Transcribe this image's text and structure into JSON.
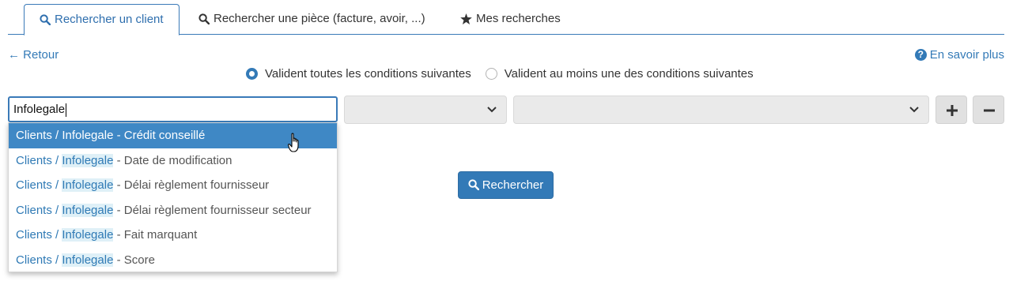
{
  "tabs": [
    {
      "label": "Rechercher un client",
      "icon": "search-icon",
      "active": true
    },
    {
      "label": "Rechercher une pièce (facture, avoir, ...)",
      "icon": "search-icon",
      "active": false
    },
    {
      "label": "Mes recherches",
      "icon": "star-icon",
      "active": false
    }
  ],
  "nav": {
    "back_label": "← Retour",
    "help_label": "En savoir plus",
    "help_icon_glyph": "?"
  },
  "match_mode": {
    "selected": "all",
    "options": [
      {
        "label": "Valident toutes les conditions suivantes"
      },
      {
        "label": "Valident au moins une des conditions suivantes"
      }
    ]
  },
  "condition": {
    "field_value": "Infolegale",
    "operator_value": "",
    "value_value": "",
    "add_icon": "plus-icon",
    "remove_icon": "minus-icon"
  },
  "autocomplete": {
    "items": [
      {
        "prefix": "Clients / ",
        "match": "Infolegale",
        "suffix": " - Crédit conseillé",
        "active": true
      },
      {
        "prefix": "Clients / ",
        "match": "Infolegale",
        "suffix": " - Date de modification",
        "active": false
      },
      {
        "prefix": "Clients / ",
        "match": "Infolegale",
        "suffix": " - Délai règlement fournisseur",
        "active": false
      },
      {
        "prefix": "Clients / ",
        "match": "Infolegale",
        "suffix": " - Délai règlement fournisseur secteur",
        "active": false
      },
      {
        "prefix": "Clients / ",
        "match": "Infolegale",
        "suffix": " - Fait marquant",
        "active": false
      },
      {
        "prefix": "Clients / ",
        "match": "Infolegale",
        "suffix": " - Score",
        "active": false
      }
    ]
  },
  "search_button": {
    "label": "Rechercher",
    "icon": "search-icon"
  },
  "colors": {
    "primary": "#337ab7",
    "highlight": "#3f88c5",
    "match_bg": "#dff0f7"
  }
}
